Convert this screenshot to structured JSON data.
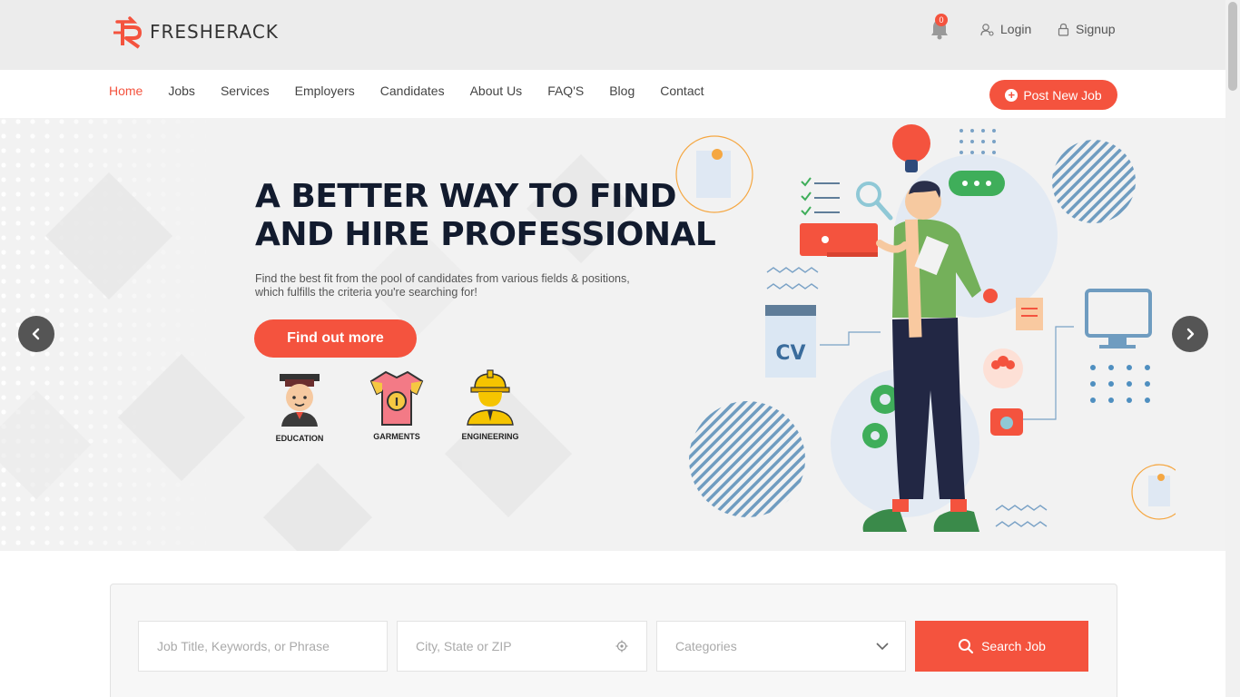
{
  "brand": {
    "name": "FRESHERACK",
    "accent": "#f4533e"
  },
  "header": {
    "notification_count": "0",
    "login": "Login",
    "signup": "Signup"
  },
  "nav": {
    "items": [
      "Home",
      "Jobs",
      "Services",
      "Employers",
      "Candidates",
      "About Us",
      "FAQ'S",
      "Blog",
      "Contact"
    ],
    "active": "Home",
    "post_job": "Post New Job"
  },
  "hero": {
    "title_line1": "A BETTER WAY TO FIND",
    "title_line2": "AND HIRE PROFESSIONAL",
    "subtitle": "Find the best fit from the pool of candidates from various fields & positions, which fulfills the criteria you're searching for!",
    "cta": "Find out more",
    "categories": [
      "EDUCATION",
      "GARMENTS",
      "ENGINEERING"
    ],
    "illustration_cv": "CV"
  },
  "search": {
    "keyword_placeholder": "Job Title, Keywords, or Phrase",
    "location_placeholder": "City, State or ZIP",
    "category_placeholder": "Categories",
    "button": "Search Job"
  }
}
